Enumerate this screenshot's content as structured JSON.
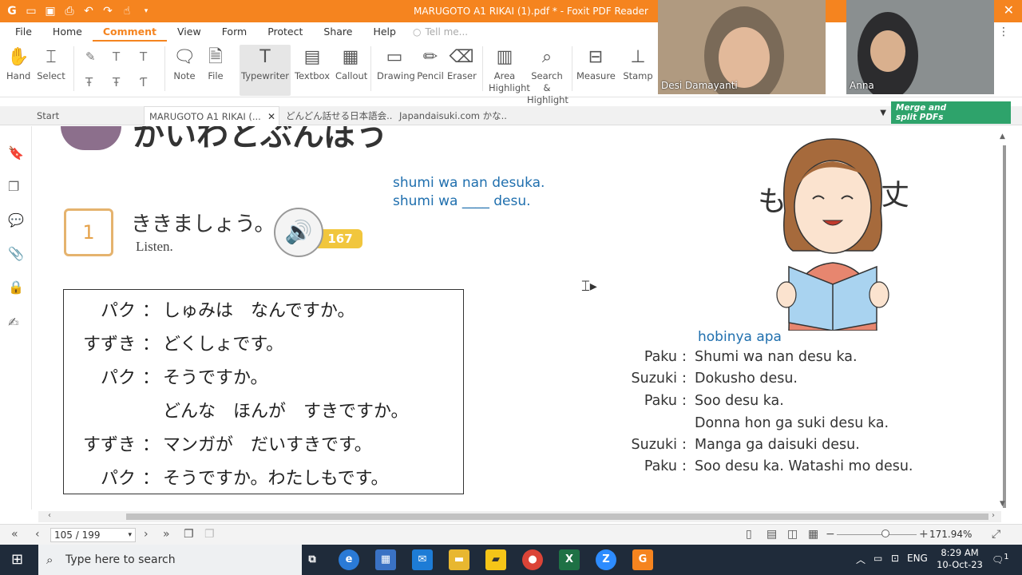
{
  "window": {
    "title": "MARUGOTO A1 RIKAI (1).pdf * - Foxit PDF Reader"
  },
  "menu": [
    "File",
    "Home",
    "Comment",
    "View",
    "Form",
    "Protect",
    "Share",
    "Help"
  ],
  "menu_active": "Comment",
  "tellme_placeholder": "Tell me...",
  "ribbon": {
    "hand": "Hand",
    "select": "Select",
    "note": "Note",
    "file": "File",
    "typewriter": "Typewriter",
    "textbox": "Textbox",
    "callout": "Callout",
    "drawing": "Drawing",
    "pencil": "Pencil",
    "eraser": "Eraser",
    "area1": "Area",
    "area2": "Highlight",
    "search1": "Search &",
    "search2": "Highlight",
    "measure": "Measure",
    "stamp": "Stamp"
  },
  "tabs": [
    {
      "label": "Start"
    },
    {
      "label": "MARUGOTO A1 RIKAI (..."
    },
    {
      "label": "どんどん話せる日本語会..."
    },
    {
      "label": "Japandaisuki.com かな..."
    }
  ],
  "promo": {
    "line1": "Merge and",
    "line2": "split PDFs"
  },
  "document": {
    "chapter_title": "かいわとぶんぽう",
    "blue_note_1": "shumi wa nan desuka.",
    "blue_note_2": "shumi wa ____ desu.",
    "exercise_number": "1",
    "exercise_title": "ききましょう。",
    "exercise_subtitle": "Listen.",
    "track_number": "167",
    "jp_dialog": [
      {
        "speaker": "パク",
        "text": "しゅみは　なんですか。"
      },
      {
        "speaker": "すずき",
        "text": "どくしょです。"
      },
      {
        "speaker": "パク",
        "text": "そうですか。"
      },
      {
        "speaker": "",
        "text": "どんな　ほんが　すきですか。"
      },
      {
        "speaker": "すずき",
        "text": "マンガが　だいすきです。"
      },
      {
        "speaker": "パク",
        "text": "そうですか。わたしもです。"
      }
    ],
    "hobi_note": "hobinya apa",
    "romaji_dialog": [
      {
        "speaker": "Paku",
        "text": "Shumi wa nan desu ka."
      },
      {
        "speaker": "Suzuki",
        "text": "Dokusho desu."
      },
      {
        "speaker": "Paku",
        "text": "Soo desu ka."
      },
      {
        "speaker": "",
        "text": "Donna hon ga suki desu ka."
      },
      {
        "speaker": "Suzuki",
        "text": "Manga ga daisuki desu."
      },
      {
        "speaker": "Paku",
        "text": "Soo desu ka. Watashi mo desu."
      }
    ],
    "illustration_kanji_left": "も",
    "illustration_kanji_right": "丈"
  },
  "status": {
    "page": "105 / 199",
    "zoom": "171.94%"
  },
  "taskbar": {
    "search_placeholder": "Type here to search",
    "lang": "ENG",
    "time": "8:29 AM",
    "date": "10-Oct-23",
    "notif_count": "1"
  },
  "video": {
    "participant1": "Desi Damayanti",
    "participant2": "Anna"
  },
  "colors": {
    "brand": "#f5841f",
    "blue_note": "#1f6fae",
    "taskbar": "#1f2b3a"
  }
}
